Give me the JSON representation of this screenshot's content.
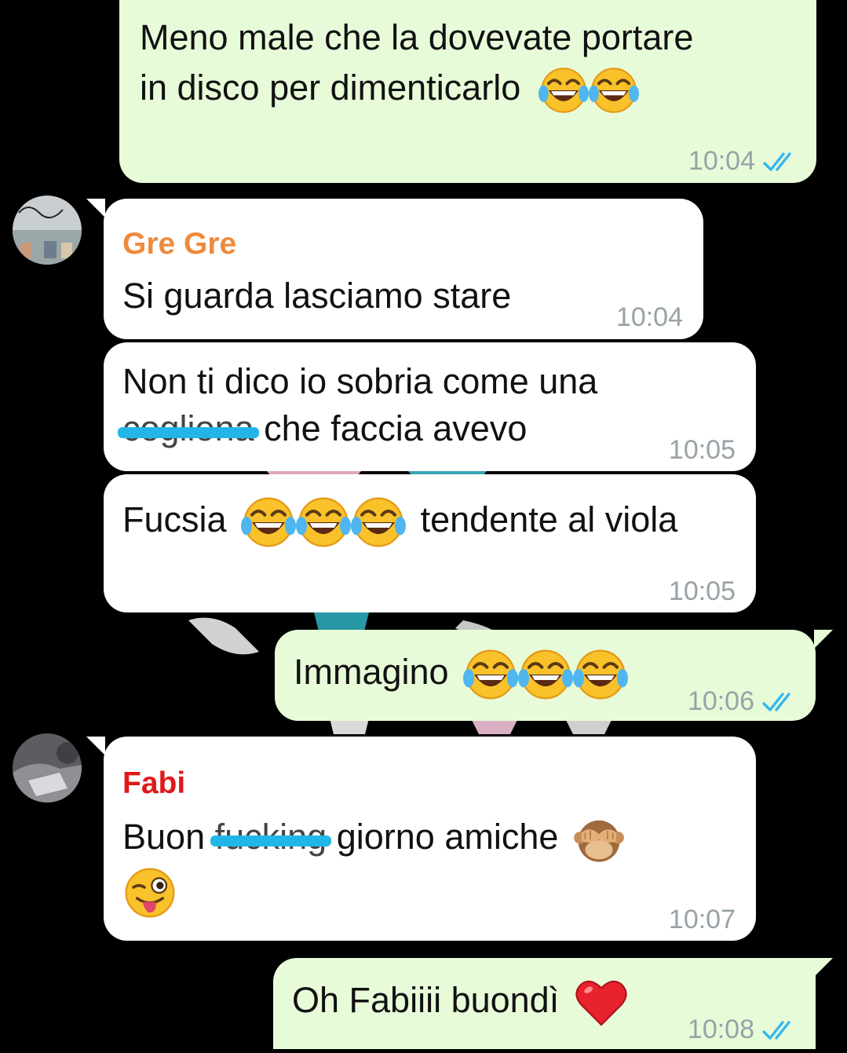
{
  "messages": {
    "m1": {
      "line1": "Meno male che la dovevate portare",
      "line2": "in disco per dimenticarlo",
      "time": "10:04"
    },
    "m2": {
      "sender": "Gre Gre",
      "text": "Si guarda lasciamo stare",
      "time": "10:04"
    },
    "m3": {
      "line1": "Non ti dico io sobria come una",
      "redacted": "cogliona",
      "line2_rest": "che faccia avevo",
      "time": "10:05"
    },
    "m4": {
      "before": "Fucsia",
      "after": "tendente al viola",
      "time": "10:05"
    },
    "m5": {
      "text": "Immagino",
      "time": "10:06"
    },
    "m6": {
      "sender": "Fabi",
      "before": "Buon",
      "redacted": "fucking",
      "after": "giorno amiche",
      "time": "10:07"
    },
    "m7": {
      "text": "Oh Fabiiii buondì",
      "time": "10:08"
    }
  },
  "icons": {
    "read_receipt": "double-check-icon",
    "laugh": "face-with-tears-of-joy-icon",
    "monkey": "see-no-evil-monkey-icon",
    "wink": "winking-face-with-tongue-icon",
    "heart": "red-heart-icon"
  },
  "colors": {
    "outgoing_bubble": "#e8fbd9",
    "incoming_bubble": "#ffffff",
    "sender_gre": "#ee8a3c",
    "sender_fabi": "#e0191a",
    "read_tick": "#34b7f1",
    "redaction": "#22b6e8"
  }
}
